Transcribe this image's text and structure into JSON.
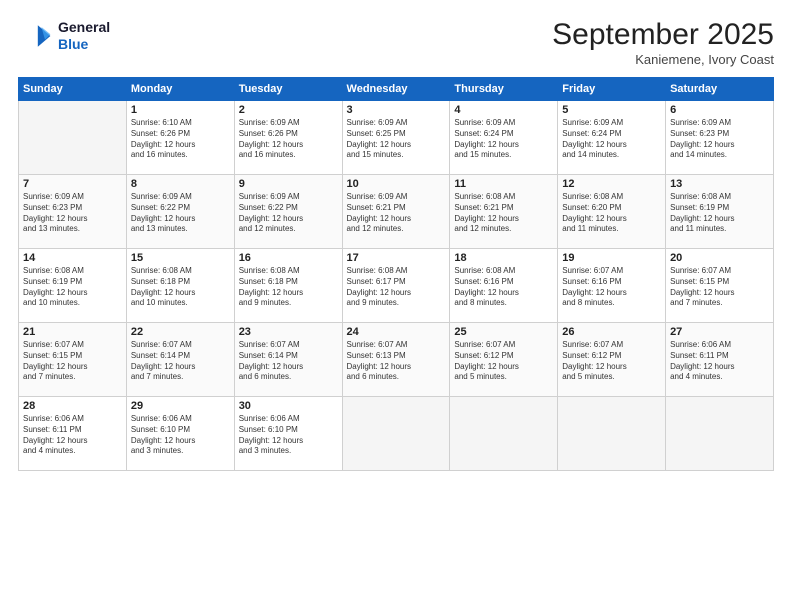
{
  "header": {
    "logo_line1": "General",
    "logo_line2": "Blue",
    "month_year": "September 2025",
    "location": "Kaniemene, Ivory Coast"
  },
  "days_of_week": [
    "Sunday",
    "Monday",
    "Tuesday",
    "Wednesday",
    "Thursday",
    "Friday",
    "Saturday"
  ],
  "weeks": [
    [
      {
        "day": "",
        "text": ""
      },
      {
        "day": "1",
        "text": "Sunrise: 6:10 AM\nSunset: 6:26 PM\nDaylight: 12 hours\nand 16 minutes."
      },
      {
        "day": "2",
        "text": "Sunrise: 6:09 AM\nSunset: 6:26 PM\nDaylight: 12 hours\nand 16 minutes."
      },
      {
        "day": "3",
        "text": "Sunrise: 6:09 AM\nSunset: 6:25 PM\nDaylight: 12 hours\nand 15 minutes."
      },
      {
        "day": "4",
        "text": "Sunrise: 6:09 AM\nSunset: 6:24 PM\nDaylight: 12 hours\nand 15 minutes."
      },
      {
        "day": "5",
        "text": "Sunrise: 6:09 AM\nSunset: 6:24 PM\nDaylight: 12 hours\nand 14 minutes."
      },
      {
        "day": "6",
        "text": "Sunrise: 6:09 AM\nSunset: 6:23 PM\nDaylight: 12 hours\nand 14 minutes."
      }
    ],
    [
      {
        "day": "7",
        "text": "Sunrise: 6:09 AM\nSunset: 6:23 PM\nDaylight: 12 hours\nand 13 minutes."
      },
      {
        "day": "8",
        "text": "Sunrise: 6:09 AM\nSunset: 6:22 PM\nDaylight: 12 hours\nand 13 minutes."
      },
      {
        "day": "9",
        "text": "Sunrise: 6:09 AM\nSunset: 6:22 PM\nDaylight: 12 hours\nand 12 minutes."
      },
      {
        "day": "10",
        "text": "Sunrise: 6:09 AM\nSunset: 6:21 PM\nDaylight: 12 hours\nand 12 minutes."
      },
      {
        "day": "11",
        "text": "Sunrise: 6:08 AM\nSunset: 6:21 PM\nDaylight: 12 hours\nand 12 minutes."
      },
      {
        "day": "12",
        "text": "Sunrise: 6:08 AM\nSunset: 6:20 PM\nDaylight: 12 hours\nand 11 minutes."
      },
      {
        "day": "13",
        "text": "Sunrise: 6:08 AM\nSunset: 6:19 PM\nDaylight: 12 hours\nand 11 minutes."
      }
    ],
    [
      {
        "day": "14",
        "text": "Sunrise: 6:08 AM\nSunset: 6:19 PM\nDaylight: 12 hours\nand 10 minutes."
      },
      {
        "day": "15",
        "text": "Sunrise: 6:08 AM\nSunset: 6:18 PM\nDaylight: 12 hours\nand 10 minutes."
      },
      {
        "day": "16",
        "text": "Sunrise: 6:08 AM\nSunset: 6:18 PM\nDaylight: 12 hours\nand 9 minutes."
      },
      {
        "day": "17",
        "text": "Sunrise: 6:08 AM\nSunset: 6:17 PM\nDaylight: 12 hours\nand 9 minutes."
      },
      {
        "day": "18",
        "text": "Sunrise: 6:08 AM\nSunset: 6:16 PM\nDaylight: 12 hours\nand 8 minutes."
      },
      {
        "day": "19",
        "text": "Sunrise: 6:07 AM\nSunset: 6:16 PM\nDaylight: 12 hours\nand 8 minutes."
      },
      {
        "day": "20",
        "text": "Sunrise: 6:07 AM\nSunset: 6:15 PM\nDaylight: 12 hours\nand 7 minutes."
      }
    ],
    [
      {
        "day": "21",
        "text": "Sunrise: 6:07 AM\nSunset: 6:15 PM\nDaylight: 12 hours\nand 7 minutes."
      },
      {
        "day": "22",
        "text": "Sunrise: 6:07 AM\nSunset: 6:14 PM\nDaylight: 12 hours\nand 7 minutes."
      },
      {
        "day": "23",
        "text": "Sunrise: 6:07 AM\nSunset: 6:14 PM\nDaylight: 12 hours\nand 6 minutes."
      },
      {
        "day": "24",
        "text": "Sunrise: 6:07 AM\nSunset: 6:13 PM\nDaylight: 12 hours\nand 6 minutes."
      },
      {
        "day": "25",
        "text": "Sunrise: 6:07 AM\nSunset: 6:12 PM\nDaylight: 12 hours\nand 5 minutes."
      },
      {
        "day": "26",
        "text": "Sunrise: 6:07 AM\nSunset: 6:12 PM\nDaylight: 12 hours\nand 5 minutes."
      },
      {
        "day": "27",
        "text": "Sunrise: 6:06 AM\nSunset: 6:11 PM\nDaylight: 12 hours\nand 4 minutes."
      }
    ],
    [
      {
        "day": "28",
        "text": "Sunrise: 6:06 AM\nSunset: 6:11 PM\nDaylight: 12 hours\nand 4 minutes."
      },
      {
        "day": "29",
        "text": "Sunrise: 6:06 AM\nSunset: 6:10 PM\nDaylight: 12 hours\nand 3 minutes."
      },
      {
        "day": "30",
        "text": "Sunrise: 6:06 AM\nSunset: 6:10 PM\nDaylight: 12 hours\nand 3 minutes."
      },
      {
        "day": "",
        "text": ""
      },
      {
        "day": "",
        "text": ""
      },
      {
        "day": "",
        "text": ""
      },
      {
        "day": "",
        "text": ""
      }
    ]
  ]
}
